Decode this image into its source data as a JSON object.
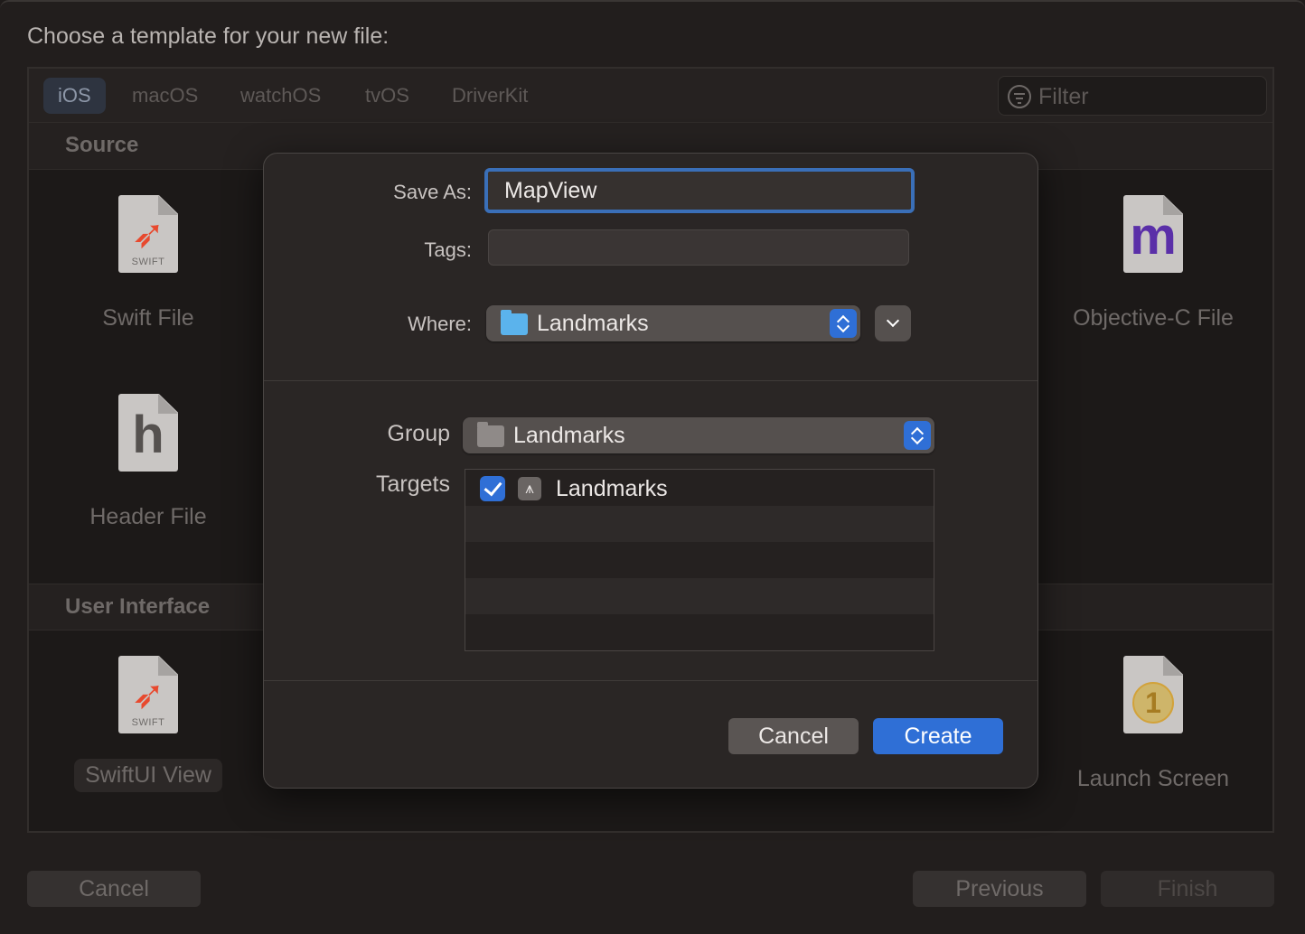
{
  "window": {
    "title": "Choose a template for your new file:"
  },
  "platforms": [
    {
      "label": "iOS",
      "active": true
    },
    {
      "label": "macOS",
      "active": false
    },
    {
      "label": "watchOS",
      "active": false
    },
    {
      "label": "tvOS",
      "active": false
    },
    {
      "label": "DriverKit",
      "active": false
    }
  ],
  "filter": {
    "placeholder": "Filter",
    "icon": "filter-icon"
  },
  "sections": {
    "source": {
      "title": "Source",
      "templates": [
        {
          "label": "Swift File",
          "icon": "swift-file-icon",
          "icon_caption": "SWIFT"
        },
        {
          "label": "Objective-C File",
          "icon": "objc-file-icon",
          "glyph": "m"
        },
        {
          "label": "Header File",
          "icon": "header-file-icon",
          "glyph": "h"
        }
      ]
    },
    "user_interface": {
      "title": "User Interface",
      "templates": [
        {
          "label": "SwiftUI View",
          "icon": "swiftui-file-icon",
          "icon_caption": "SWIFT",
          "selected": true
        },
        {
          "label": "Launch Screen",
          "icon": "launch-screen-icon",
          "glyph": "1"
        }
      ]
    }
  },
  "footer": {
    "cancel": "Cancel",
    "previous": "Previous",
    "finish": "Finish"
  },
  "sheet": {
    "save_as_label": "Save As:",
    "save_as_value": "MapView",
    "tags_label": "Tags:",
    "tags_value": "",
    "where_label": "Where:",
    "where_value": "Landmarks",
    "group_label": "Group",
    "group_value": "Landmarks",
    "targets_label": "Targets",
    "targets": [
      {
        "label": "Landmarks",
        "checked": true,
        "icon": "app-target-icon"
      }
    ],
    "cancel": "Cancel",
    "create": "Create"
  },
  "colors": {
    "accent": "#2f6fd6",
    "focus_ring": "#3a6fb8",
    "objc_glyph": "#5a2fa8",
    "swift_orange": "#e8492e",
    "launch_gold": "#d2a23a"
  }
}
